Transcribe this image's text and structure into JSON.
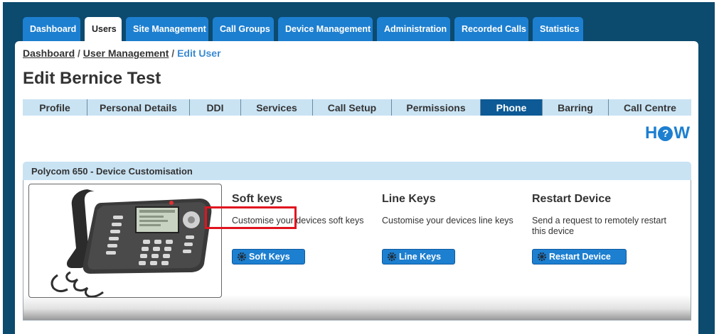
{
  "nav": {
    "tabs": [
      {
        "label": "Dashboard"
      },
      {
        "label": "Users"
      },
      {
        "label": "Site Management"
      },
      {
        "label": "Call Groups"
      },
      {
        "label": "Device Management"
      },
      {
        "label": "Administration"
      },
      {
        "label": "Recorded Calls"
      },
      {
        "label": "Statistics"
      }
    ],
    "active_tab": "Users"
  },
  "breadcrumb": {
    "items": [
      "Dashboard",
      "User Management"
    ],
    "separator": "/",
    "current": "Edit User"
  },
  "page": {
    "title": "Edit Bernice Test",
    "help_logo": {
      "left": "H",
      "middle": "?",
      "right": "W"
    }
  },
  "sub_tabs": {
    "items": [
      {
        "label": "Profile"
      },
      {
        "label": "Personal Details"
      },
      {
        "label": "DDI"
      },
      {
        "label": "Services"
      },
      {
        "label": "Call Setup"
      },
      {
        "label": "Permissions"
      },
      {
        "label": "Phone"
      },
      {
        "label": "Barring"
      },
      {
        "label": "Call Centre"
      }
    ],
    "active": "Phone"
  },
  "device": {
    "section_title": "Polycom 650 - Device Customisation",
    "image_icon": "desk-phone-image",
    "columns": [
      {
        "heading": "Soft keys",
        "description": "Customise your devices soft keys",
        "button": "Soft Keys",
        "icon": "gear-icon"
      },
      {
        "heading": "Line Keys",
        "description": "Customise your devices line keys",
        "button": "Line Keys",
        "icon": "gear-icon"
      },
      {
        "heading": "Restart Device",
        "description": "Send a request to remotely restart this device",
        "button": "Restart Device",
        "icon": "gear-icon"
      }
    ]
  },
  "colors": {
    "frame": "#0c4a6e",
    "tab_blue": "#1d7fd0",
    "subtab_bg": "#c9e3f3",
    "subtab_active": "#0d5a96",
    "highlight": "#e0141e"
  }
}
